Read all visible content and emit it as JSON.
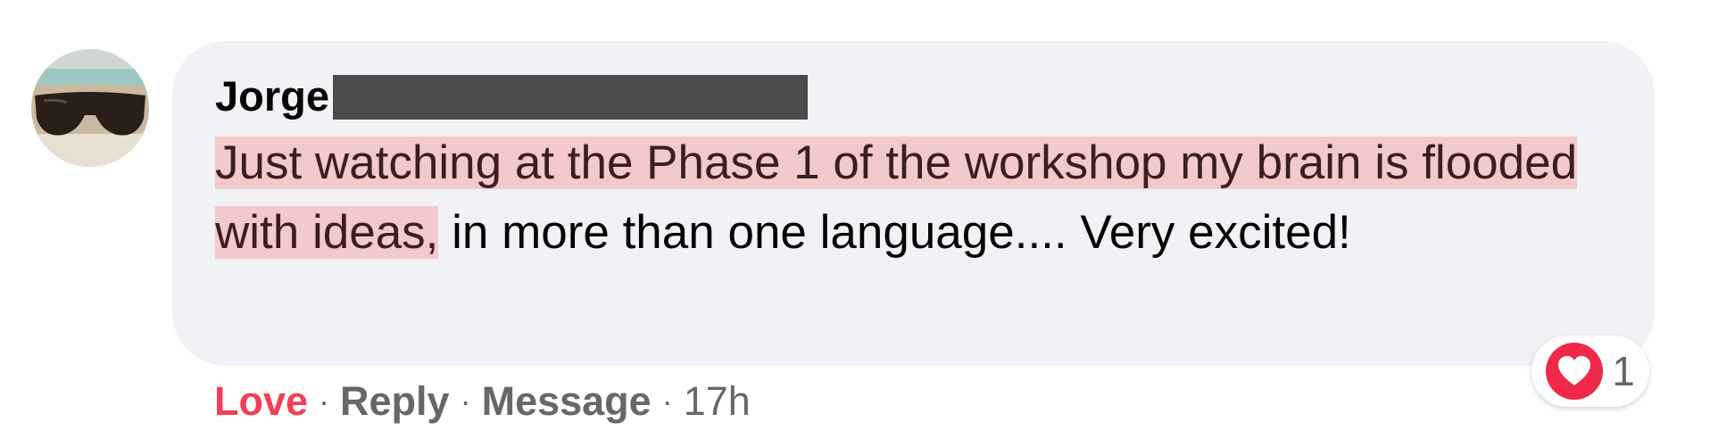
{
  "comment": {
    "author": "Jorge",
    "text_highlighted": "Just watching at the Phase 1 of the workshop my brain is flooded with ideas,",
    "text_rest": " in more than one language.... Very excited!"
  },
  "reaction": {
    "icon": "heart-icon",
    "count": "1",
    "color": "#f0284a"
  },
  "actions": {
    "love_label": "Love",
    "reply_label": "Reply",
    "message_label": "Message",
    "separator": "·",
    "timestamp": "17h"
  },
  "colors": {
    "bubble": "#f0f2f5",
    "highlight": "#f3c9cc",
    "love": "#f33e58",
    "secondary_text": "#65676b"
  }
}
